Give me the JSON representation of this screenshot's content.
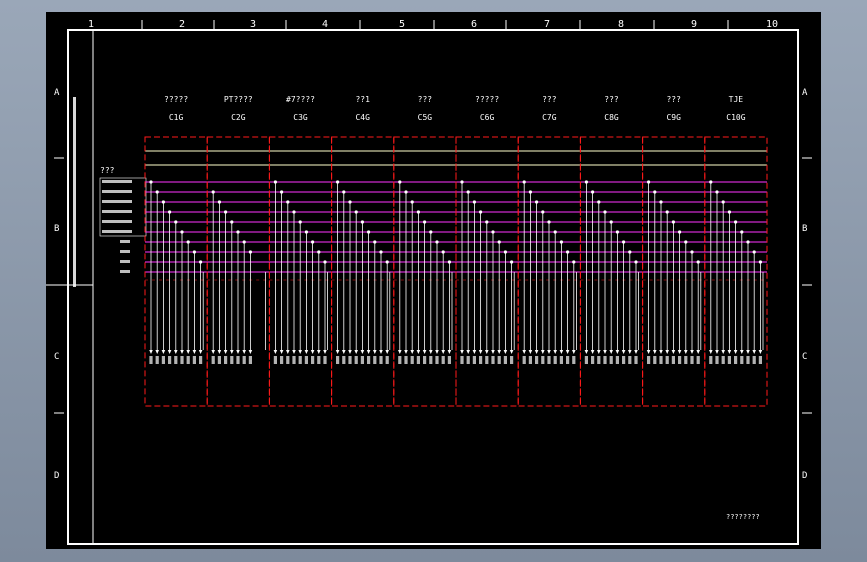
{
  "title_block_text": "????????",
  "grid": {
    "columns": [
      "1",
      "2",
      "3",
      "4",
      "5",
      "6",
      "7",
      "8",
      "9",
      "10"
    ],
    "rows": [
      "A",
      "B",
      "C",
      "D"
    ]
  },
  "side_title": "???",
  "feeders": [
    {
      "name": "?????",
      "code": "C1G"
    },
    {
      "name": "PT????",
      "code": "C2G"
    },
    {
      "name": "#7????",
      "code": "C3G"
    },
    {
      "name": "??1",
      "code": "C4G"
    },
    {
      "name": "???",
      "code": "C5G"
    },
    {
      "name": "?????",
      "code": "C6G"
    },
    {
      "name": "???",
      "code": "C7G"
    },
    {
      "name": "???",
      "code": "C8G"
    },
    {
      "name": "???",
      "code": "C9G"
    },
    {
      "name": "TJE",
      "code": "C10G"
    }
  ],
  "colors": {
    "background": "#000000",
    "border": "#ffffff",
    "bus": "#ff33ff",
    "cabinet_outline": "#ff1a1a",
    "wire": "#ffffff",
    "supply_line": "#ffffcc"
  }
}
